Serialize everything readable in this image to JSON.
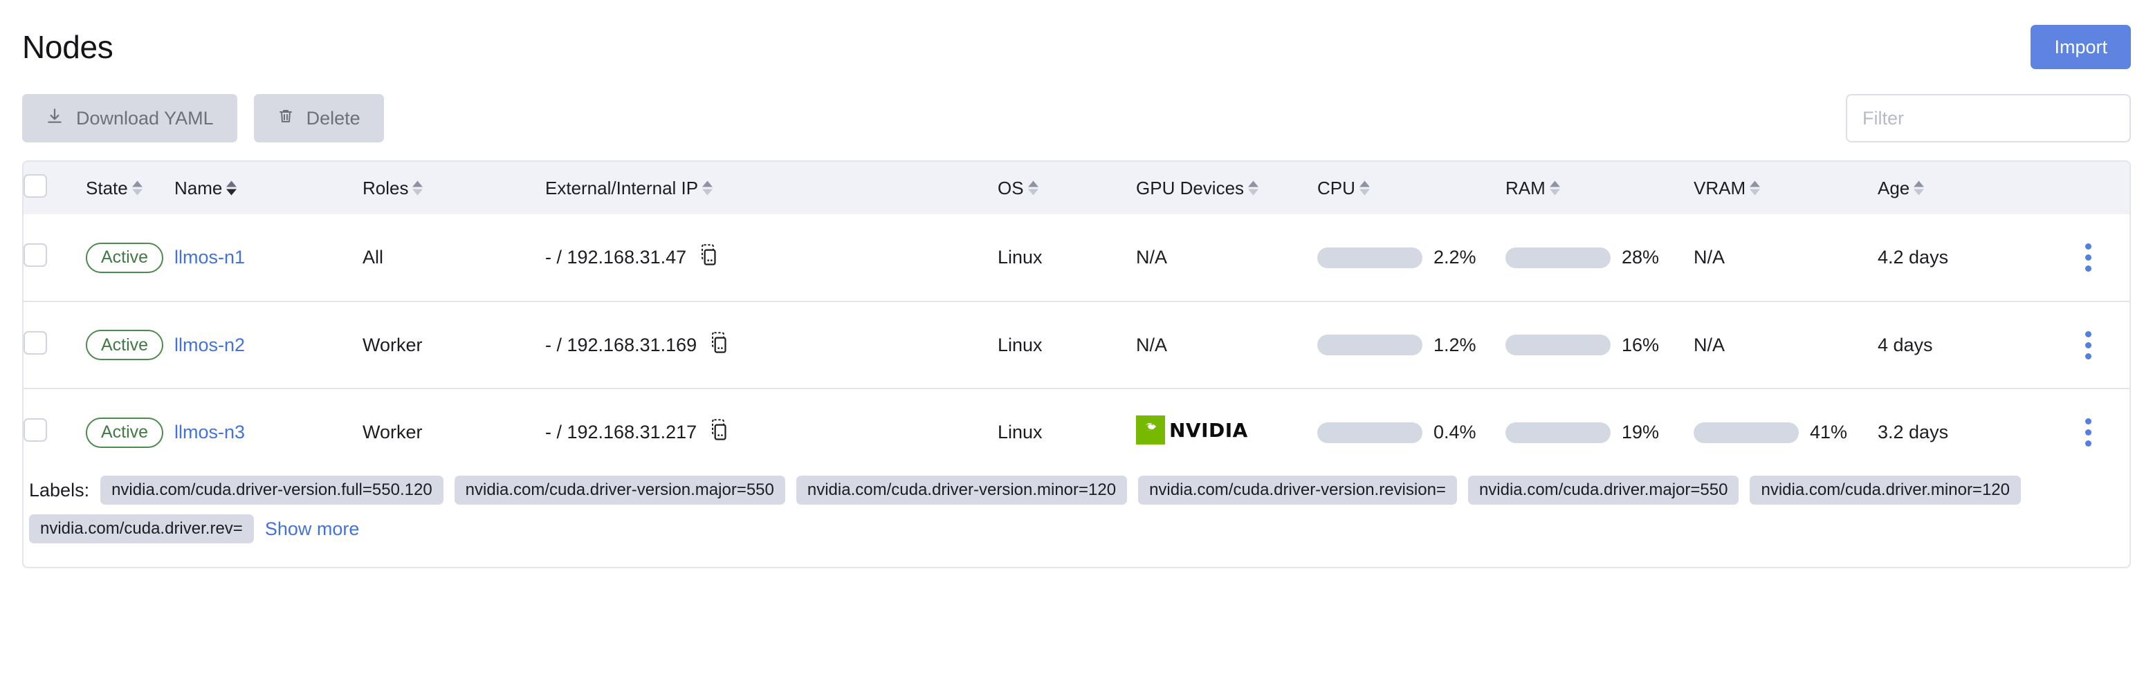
{
  "header": {
    "title": "Nodes",
    "import_label": "Import"
  },
  "toolbar": {
    "download_yaml_label": "Download YAML",
    "delete_label": "Delete",
    "filter_placeholder": "Filter",
    "filter_value": ""
  },
  "table": {
    "columns": [
      {
        "label": "State",
        "sortable": true,
        "active_sort": false
      },
      {
        "label": "Name",
        "sortable": true,
        "active_sort": true
      },
      {
        "label": "Roles",
        "sortable": true,
        "active_sort": false
      },
      {
        "label": "External/Internal IP",
        "sortable": true,
        "active_sort": false
      },
      {
        "label": "OS",
        "sortable": true,
        "active_sort": false
      },
      {
        "label": "GPU Devices",
        "sortable": true,
        "active_sort": false
      },
      {
        "label": "CPU",
        "sortable": true,
        "active_sort": false
      },
      {
        "label": "RAM",
        "sortable": true,
        "active_sort": false
      },
      {
        "label": "VRAM",
        "sortable": true,
        "active_sort": false
      },
      {
        "label": "Age",
        "sortable": true,
        "active_sort": false
      }
    ],
    "rows": [
      {
        "state": "Active",
        "name": "llmos-n1",
        "roles": "All",
        "ip": "- / 192.168.31.47",
        "os": "Linux",
        "gpu": "N/A",
        "gpu_is_nvidia": false,
        "cpu_label": "2.2%",
        "cpu_pct": 2.2,
        "ram_label": "28%",
        "ram_pct": 28,
        "vram_label": "N/A",
        "vram_pct": null,
        "age": "4.2 days"
      },
      {
        "state": "Active",
        "name": "llmos-n2",
        "roles": "Worker",
        "ip": "- / 192.168.31.169",
        "os": "Linux",
        "gpu": "N/A",
        "gpu_is_nvidia": false,
        "cpu_label": "1.2%",
        "cpu_pct": 1.2,
        "ram_label": "16%",
        "ram_pct": 16,
        "vram_label": "N/A",
        "vram_pct": null,
        "age": "4 days"
      },
      {
        "state": "Active",
        "name": "llmos-n3",
        "roles": "Worker",
        "ip": "- / 192.168.31.217",
        "os": "Linux",
        "gpu": "NVIDIA",
        "gpu_is_nvidia": true,
        "cpu_label": "0.4%",
        "cpu_pct": 0.4,
        "ram_label": "19%",
        "ram_pct": 19,
        "vram_label": "41%",
        "vram_pct": 41,
        "age": "3.2 days"
      }
    ],
    "labels_row": {
      "caption": "Labels:",
      "chips": [
        "nvidia.com/cuda.driver-version.full=550.120",
        "nvidia.com/cuda.driver-version.major=550",
        "nvidia.com/cuda.driver-version.minor=120",
        "nvidia.com/cuda.driver-version.revision=",
        "nvidia.com/cuda.driver.major=550",
        "nvidia.com/cuda.driver.minor=120",
        "nvidia.com/cuda.driver.rev="
      ],
      "show_more_label": "Show more"
    }
  },
  "colors": {
    "accent_blue": "#5e83e0",
    "link_blue": "#4472d6",
    "meter_fill": "#5280e0",
    "meter_track": "#d4d8e2",
    "badge_green": "#3f7a43",
    "nvidia_green": "#76b900",
    "chip_bg": "#d7dae4",
    "header_bg": "#f0f2f7",
    "border": "#e3e5eb"
  }
}
